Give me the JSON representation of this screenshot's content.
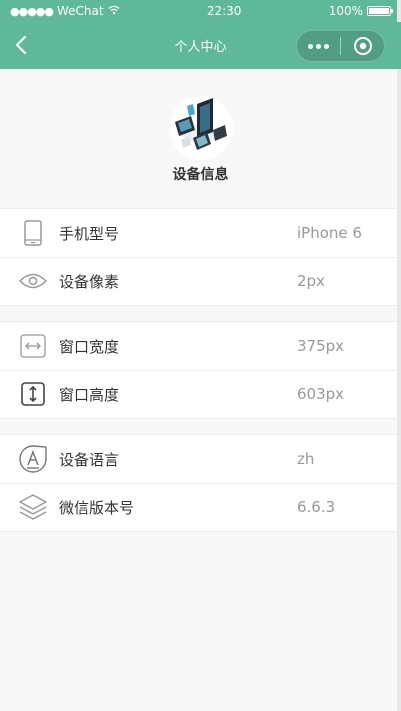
{
  "status_bar": {
    "carrier": "WeChat",
    "time": "22:30",
    "battery": "100%"
  },
  "nav": {
    "title": "个人中心"
  },
  "header": {
    "title": "设备信息"
  },
  "groups": [
    {
      "rows": [
        {
          "label": "手机型号",
          "value": "iPhone 6",
          "icon": "phone-icon"
        },
        {
          "label": "设备像素",
          "value": "2px",
          "icon": "eye-icon"
        }
      ]
    },
    {
      "rows": [
        {
          "label": "窗口宽度",
          "value": "375px",
          "icon": "width-arrows-icon"
        },
        {
          "label": "窗口高度",
          "value": "603px",
          "icon": "height-arrows-icon"
        }
      ]
    },
    {
      "rows": [
        {
          "label": "设备语言",
          "value": "zh",
          "icon": "language-icon"
        },
        {
          "label": "微信版本号",
          "value": "6.6.3",
          "icon": "layers-icon"
        }
      ]
    }
  ],
  "colors": {
    "accent": "#5fb89a",
    "background": "#f8f8f8"
  }
}
